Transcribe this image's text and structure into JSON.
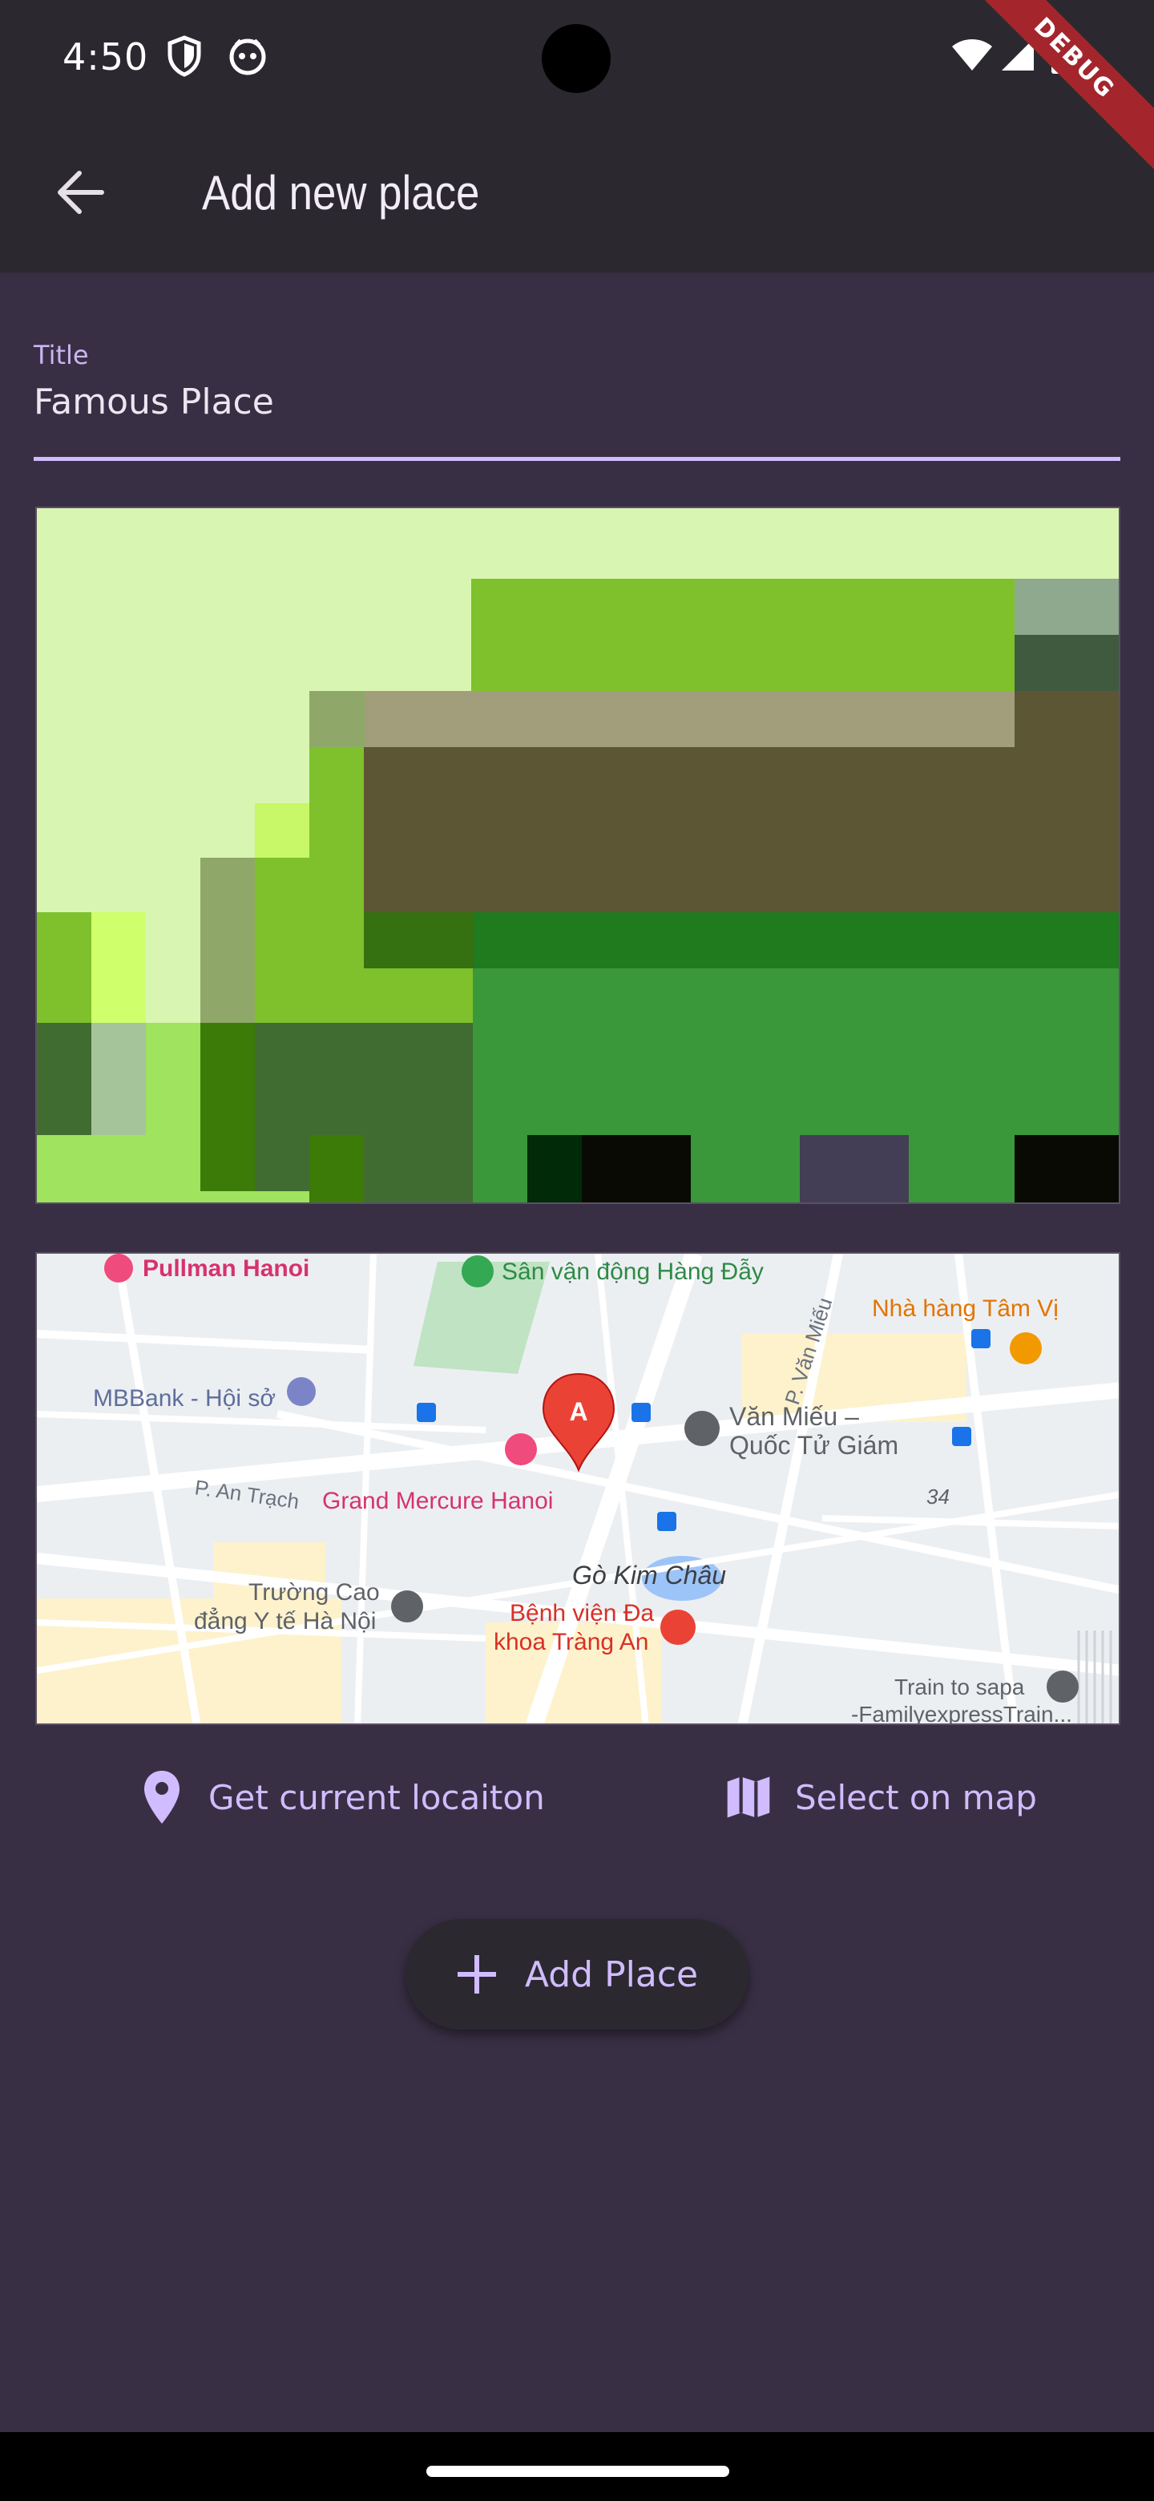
{
  "status_bar": {
    "time": "4:50",
    "debug_label": "DEBUG",
    "icons": [
      "shield-icon",
      "robot-face-icon",
      "wifi-icon",
      "cellular-signal-icon",
      "battery-icon"
    ]
  },
  "app_bar": {
    "title": "Add new place",
    "back_icon": "arrow-back-icon"
  },
  "title_field": {
    "label": "Title",
    "value": "Famous Place"
  },
  "map": {
    "labels": {
      "pullman": "Pullman Hanoi",
      "stadium": "Sân vận động Hàng Đẫy",
      "restaurant": "Nhà hàng Tâm Vị",
      "street_van_mieu": "P. Văn Miếu",
      "mbbank": "MBBank - Hội sở",
      "van_mieu_1": "Văn Miếu –",
      "van_mieu_2": "Quốc Tử Giám",
      "an_trach": "P. An Trạch",
      "grand_mercure": "Grand Mercure Hanoi",
      "num_34": "34",
      "go_kim_chau": "Gò Kim Châu",
      "school_1": "Trường Cao",
      "school_2": "đẳng Y tế Hà Nội",
      "hospital_1": "Bệnh viện Đa",
      "hospital_2": "khoa Tràng An",
      "train_1": "Train to sapa",
      "train_2": "-FamilyexpressTrain...",
      "marker": "A"
    }
  },
  "actions": {
    "current_location": "Get current locaiton",
    "select_on_map": "Select on map",
    "add_place": "Add Place"
  },
  "colors": {
    "background": "#382f44",
    "app_bar": "#2b2830",
    "accent": "#d0bcff",
    "marker": "#ea4335"
  }
}
